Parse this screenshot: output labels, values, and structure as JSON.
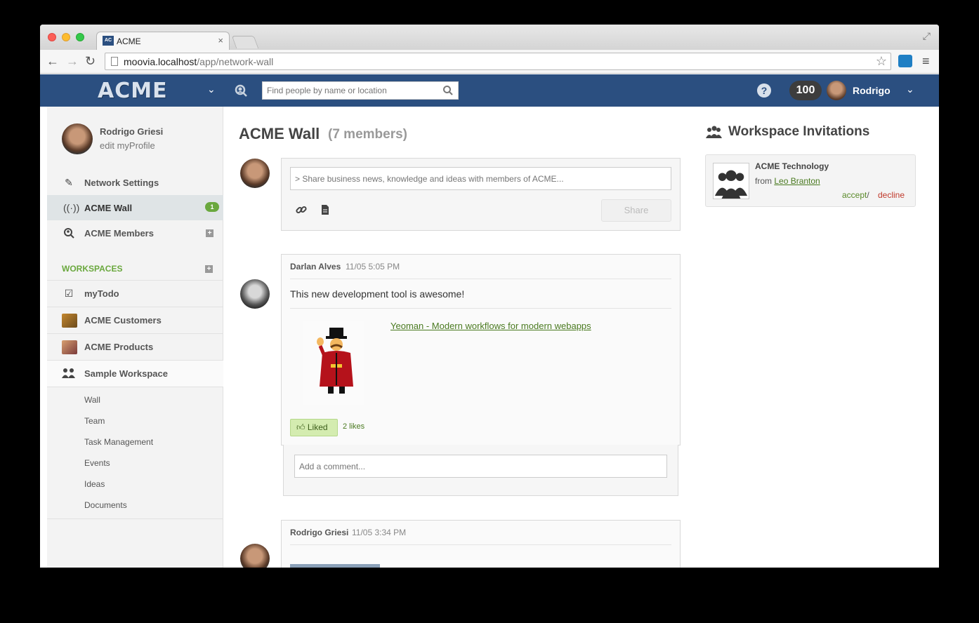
{
  "browser": {
    "tab_title": "ACME",
    "favicon_text": "AC",
    "url_host": "moovia.localhost",
    "url_path": "/app/network-wall"
  },
  "header": {
    "logo": "ACME",
    "search_placeholder": "Find people by name or location",
    "points": "100",
    "username": "Rodrigo",
    "brand_color": "#2b4f80"
  },
  "sidebar": {
    "profile_name": "Rodrigo Griesi",
    "profile_edit": "edit myProfile",
    "nav": [
      {
        "label": "Network Settings",
        "icon": "edit-icon"
      },
      {
        "label": "ACME Wall",
        "icon": "broadcast-icon",
        "badge": "1"
      },
      {
        "label": "ACME Members",
        "icon": "member-search-icon"
      }
    ],
    "workspaces_heading": "WORKSPACES",
    "workspaces": [
      {
        "label": "myTodo",
        "icon": "checkbox-icon"
      },
      {
        "label": "ACME Customers",
        "icon": "workspace-thumbnail"
      },
      {
        "label": "ACME Products",
        "icon": "workspace-thumbnail"
      },
      {
        "label": "Sample Workspace",
        "icon": "group-icon"
      }
    ],
    "sub_items": [
      "Wall",
      "Team",
      "Task Management",
      "Events",
      "Ideas",
      "Documents"
    ]
  },
  "main": {
    "title": "ACME Wall",
    "member_count": "(7 members)",
    "composer_placeholder": "> Share business news, knowledge and ideas with members of ACME...",
    "share_label": "Share",
    "posts": [
      {
        "author": "Darlan Alves",
        "time": "11/05 5:05 PM",
        "text": "This new development tool is awesome!",
        "link_title": "Yeoman - Modern workflows for modern webapps",
        "liked_label": "Liked",
        "likes": "2 likes"
      },
      {
        "author": "Rodrigo Griesi",
        "time": "11/05 3:34 PM"
      }
    ],
    "comment_placeholder": "Add a comment..."
  },
  "invitations": {
    "title": "Workspace Invitations",
    "items": [
      {
        "name": "ACME Technology",
        "from_prefix": "from",
        "from_name": "Leo Branton",
        "accept": "accept",
        "separator": "/",
        "decline": "decline"
      }
    ]
  }
}
